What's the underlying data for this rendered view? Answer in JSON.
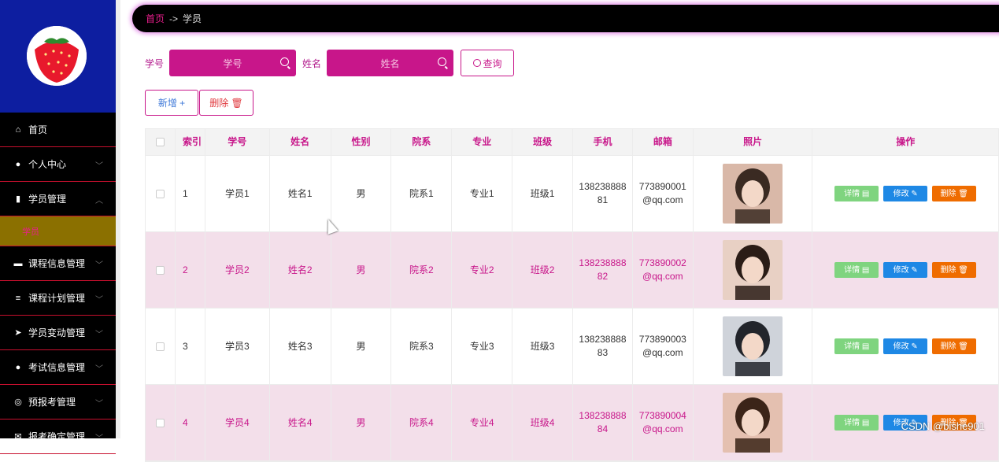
{
  "breadcrumb": {
    "home": "首页",
    "separator": "->",
    "current": "学员"
  },
  "sidebar": {
    "items": [
      {
        "label": "首页",
        "icon": "home-icon"
      },
      {
        "label": "个人中心",
        "icon": "user-icon"
      },
      {
        "label": "学员管理",
        "icon": "bar-chart-icon"
      },
      {
        "label": "学员",
        "icon": ""
      },
      {
        "label": "课程信息管理",
        "icon": "briefcase-icon"
      },
      {
        "label": "课程计划管理",
        "icon": "list-icon"
      },
      {
        "label": "学员变动管理",
        "icon": "send-icon"
      },
      {
        "label": "考试信息管理",
        "icon": "user-icon"
      },
      {
        "label": "预报考管理",
        "icon": "globe-icon"
      },
      {
        "label": "报考确定管理",
        "icon": "mail-icon"
      }
    ]
  },
  "search": {
    "no_label": "学号",
    "no_placeholder": "学号",
    "name_label": "姓名",
    "name_placeholder": "姓名",
    "query_label": "查询"
  },
  "actions": {
    "add_label": "新增 +",
    "delete_label": "删除 🗑"
  },
  "table": {
    "headers": [
      "索引",
      "学号",
      "姓名",
      "性别",
      "院系",
      "专业",
      "班级",
      "手机",
      "邮箱",
      "照片",
      "操作"
    ],
    "rows": [
      {
        "index": "1",
        "no": "学员1",
        "name": "姓名1",
        "sex": "男",
        "dept": "院系1",
        "major": "专业1",
        "cls": "班级1",
        "phone": "138238888\n81",
        "mail": "773890001\n@qq.com"
      },
      {
        "index": "2",
        "no": "学员2",
        "name": "姓名2",
        "sex": "男",
        "dept": "院系2",
        "major": "专业2",
        "cls": "班级2",
        "phone": "138238888\n82",
        "mail": "773890002\n@qq.com"
      },
      {
        "index": "3",
        "no": "学员3",
        "name": "姓名3",
        "sex": "男",
        "dept": "院系3",
        "major": "专业3",
        "cls": "班级3",
        "phone": "138238888\n83",
        "mail": "773890003\n@qq.com"
      },
      {
        "index": "4",
        "no": "学员4",
        "name": "姓名4",
        "sex": "男",
        "dept": "院系4",
        "major": "专业4",
        "cls": "班级4",
        "phone": "138238888\n84",
        "mail": "773890004\n@qq.com"
      }
    ],
    "op_labels": {
      "detail": "详情 ▤",
      "edit": "修改 ✎",
      "delete": "删除 🗑"
    }
  },
  "watermark": "CSDN @bishe901",
  "colors": {
    "accent": "#c8168a",
    "sidebar_bg": "#000000",
    "brand_bg": "#0d1ea0"
  }
}
